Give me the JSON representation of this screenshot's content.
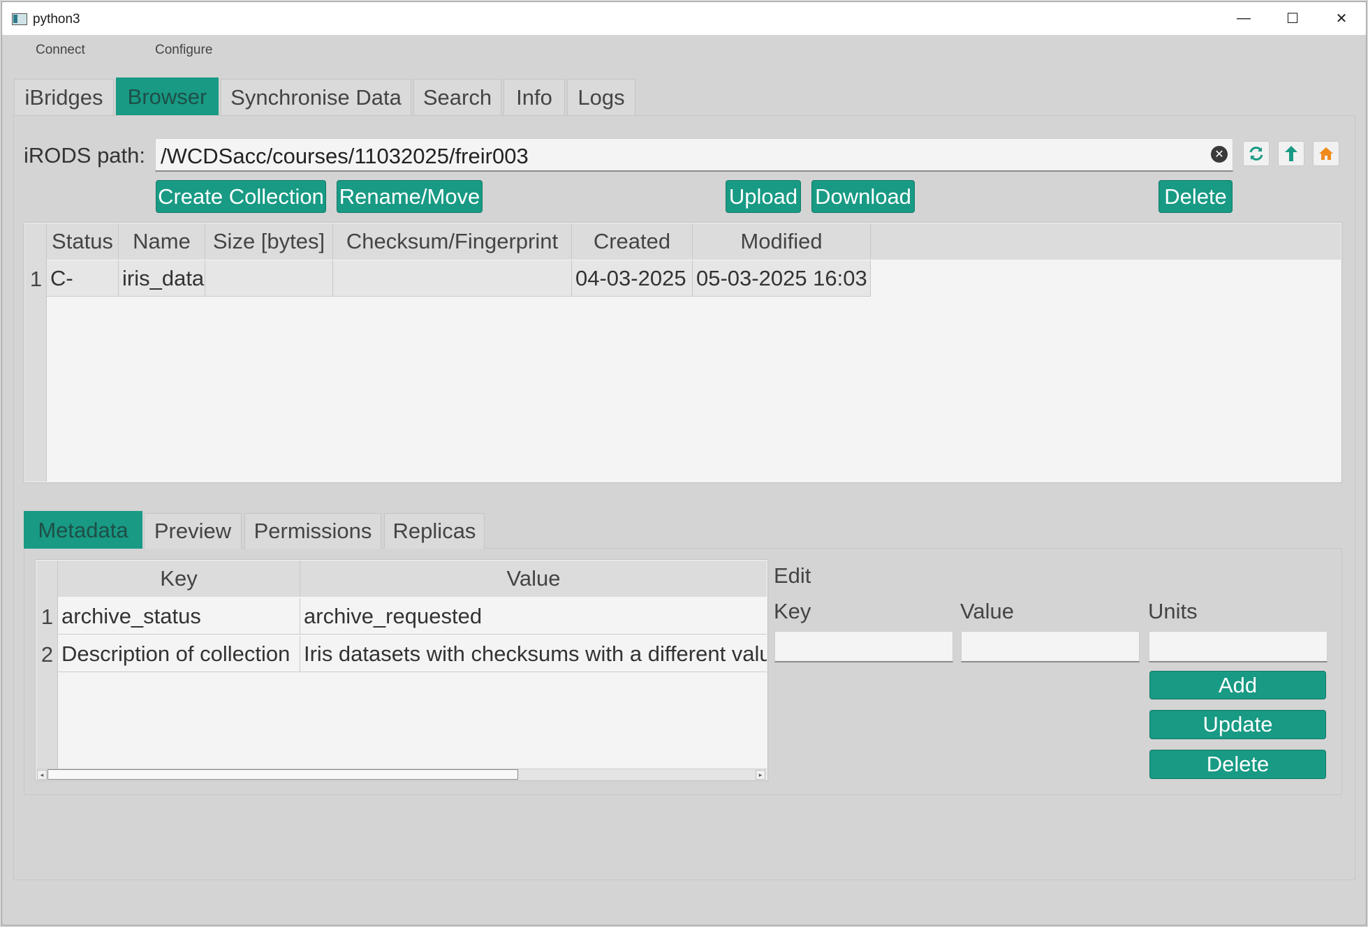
{
  "window": {
    "title": "python3",
    "controls": {
      "minimize": "—",
      "maximize": "☐",
      "close": "✕"
    }
  },
  "menu": [
    "Connect",
    "Configure"
  ],
  "main_tabs": [
    "iBridges",
    "Browser",
    "Synchronise Data",
    "Search",
    "Info",
    "Logs"
  ],
  "active_main_tab": "Browser",
  "path": {
    "label": "iRODS path:",
    "value": "/WCDSacc/courses/11032025/freir003"
  },
  "icons": [
    "clear-icon",
    "refresh-icon",
    "parent-folder-icon",
    "home-icon"
  ],
  "actions": {
    "create": "Create Collection",
    "rename": "Rename/Move",
    "upload": "Upload",
    "download": "Download",
    "delete": "Delete"
  },
  "browser_table": {
    "columns": [
      "Status",
      "Name",
      "Size [bytes]",
      "Checksum/Fingerprint",
      "Created",
      "Modified"
    ],
    "rows": [
      {
        "num": "1",
        "status": "C-",
        "name": "iris_data",
        "size": "",
        "checksum": "",
        "created": "04-03-2025",
        "modified": "05-03-2025 16:03"
      }
    ]
  },
  "sub_tabs": [
    "Metadata",
    "Preview",
    "Permissions",
    "Replicas"
  ],
  "active_sub_tab": "Metadata",
  "metadata_table": {
    "columns": [
      "Key",
      "Value"
    ],
    "rows": [
      {
        "num": "1",
        "key": "archive_status",
        "value": "archive_requested"
      },
      {
        "num": "2",
        "key": "Description of collection",
        "value": "Iris datasets with checksums with a different valu"
      }
    ]
  },
  "edit": {
    "title": "Edit",
    "key_label": "Key",
    "value_label": "Value",
    "units_label": "Units",
    "key_value": "",
    "value_value": "",
    "units_value": "",
    "add": "Add",
    "update": "Update",
    "delete": "Delete"
  },
  "colors": {
    "accent": "#189a84",
    "panel": "#d4d4d4",
    "table_bg": "#f4f4f4"
  }
}
